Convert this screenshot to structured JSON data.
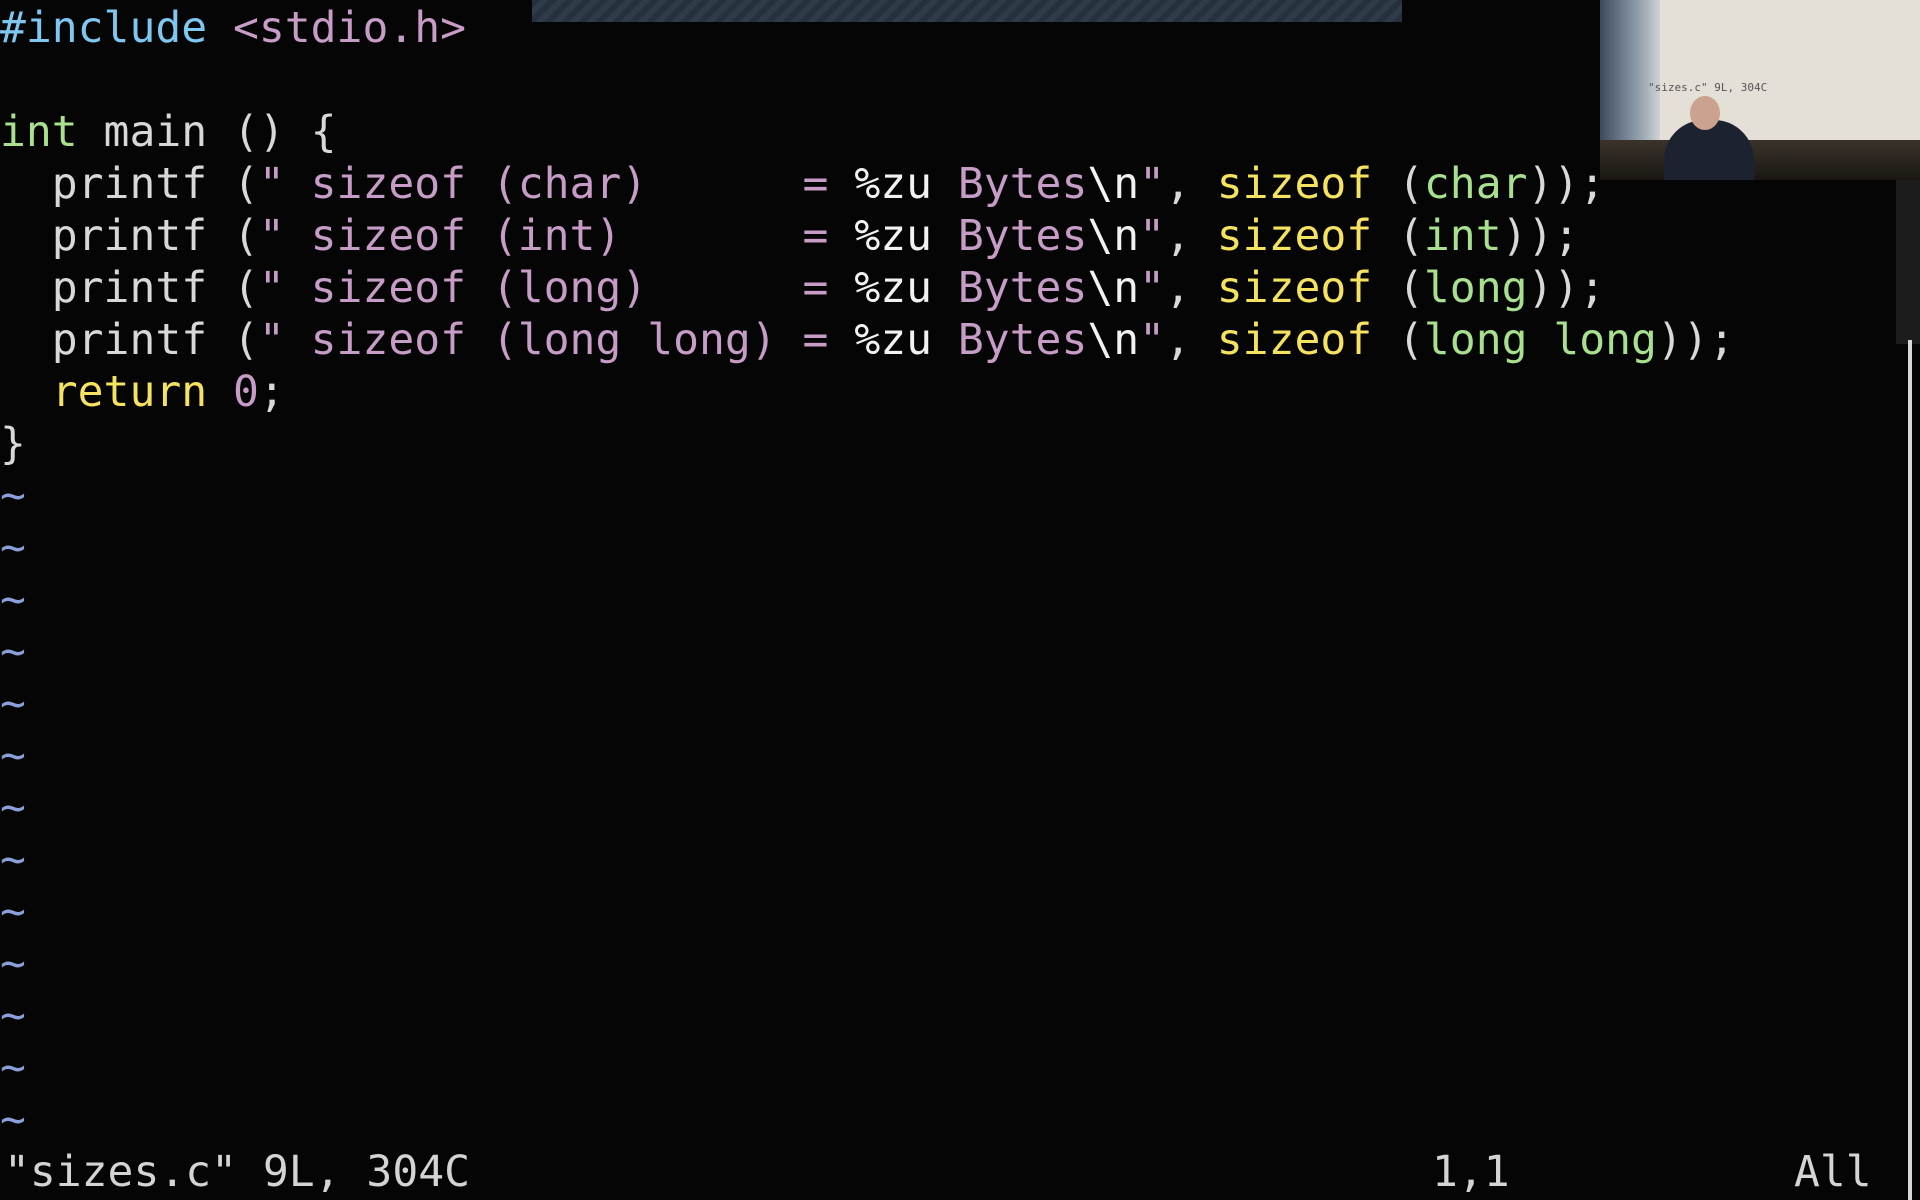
{
  "editor": {
    "lines": [
      {
        "tokens": [
          {
            "t": "#include",
            "c": "inc"
          },
          {
            "t": " ",
            "c": "plain"
          },
          {
            "t": "<stdio.h>",
            "c": "hdr"
          }
        ]
      },
      {
        "tokens": []
      },
      {
        "tokens": [
          {
            "t": "int",
            "c": "type"
          },
          {
            "t": " main () {",
            "c": "plain"
          }
        ]
      },
      {
        "tokens": [
          {
            "t": "  printf (",
            "c": "plain"
          },
          {
            "t": "\" sizeof (char)      = ",
            "c": "str"
          },
          {
            "t": "%zu",
            "c": "esc"
          },
          {
            "t": " Bytes",
            "c": "str"
          },
          {
            "t": "\\n",
            "c": "esc"
          },
          {
            "t": "\"",
            "c": "str"
          },
          {
            "t": ", ",
            "c": "plain"
          },
          {
            "t": "sizeof",
            "c": "kw"
          },
          {
            "t": " (",
            "c": "plain"
          },
          {
            "t": "char",
            "c": "type"
          },
          {
            "t": "));",
            "c": "plain"
          }
        ]
      },
      {
        "tokens": [
          {
            "t": "  printf (",
            "c": "plain"
          },
          {
            "t": "\" sizeof (int)       = ",
            "c": "str"
          },
          {
            "t": "%zu",
            "c": "esc"
          },
          {
            "t": " Bytes",
            "c": "str"
          },
          {
            "t": "\\n",
            "c": "esc"
          },
          {
            "t": "\"",
            "c": "str"
          },
          {
            "t": ", ",
            "c": "plain"
          },
          {
            "t": "sizeof",
            "c": "kw"
          },
          {
            "t": " (",
            "c": "plain"
          },
          {
            "t": "int",
            "c": "type"
          },
          {
            "t": "));",
            "c": "plain"
          }
        ]
      },
      {
        "tokens": [
          {
            "t": "  printf (",
            "c": "plain"
          },
          {
            "t": "\" sizeof (long)      = ",
            "c": "str"
          },
          {
            "t": "%zu",
            "c": "esc"
          },
          {
            "t": " Bytes",
            "c": "str"
          },
          {
            "t": "\\n",
            "c": "esc"
          },
          {
            "t": "\"",
            "c": "str"
          },
          {
            "t": ", ",
            "c": "plain"
          },
          {
            "t": "sizeof",
            "c": "kw"
          },
          {
            "t": " (",
            "c": "plain"
          },
          {
            "t": "long",
            "c": "type"
          },
          {
            "t": "));",
            "c": "plain"
          }
        ]
      },
      {
        "tokens": [
          {
            "t": "  printf (",
            "c": "plain"
          },
          {
            "t": "\" sizeof (long long) = ",
            "c": "str"
          },
          {
            "t": "%zu",
            "c": "esc"
          },
          {
            "t": " Bytes",
            "c": "str"
          },
          {
            "t": "\\n",
            "c": "esc"
          },
          {
            "t": "\"",
            "c": "str"
          },
          {
            "t": ", ",
            "c": "plain"
          },
          {
            "t": "sizeof",
            "c": "kw"
          },
          {
            "t": " (",
            "c": "plain"
          },
          {
            "t": "long long",
            "c": "type"
          },
          {
            "t": "));",
            "c": "plain"
          }
        ]
      },
      {
        "tokens": [
          {
            "t": "  ",
            "c": "plain"
          },
          {
            "t": "return",
            "c": "kw"
          },
          {
            "t": " ",
            "c": "plain"
          },
          {
            "t": "0",
            "c": "num"
          },
          {
            "t": ";",
            "c": "plain"
          }
        ]
      },
      {
        "tokens": [
          {
            "t": "}",
            "c": "plain"
          }
        ]
      }
    ],
    "empty_marker": "~",
    "empty_line_count": 13
  },
  "status_bar": {
    "message": "\"sizes.c\" 9L, 304C",
    "cursor_position": "1,1",
    "scroll_position": "All"
  },
  "webcam": {
    "screen_text": "\"sizes.c\" 9L, 304C"
  },
  "colors": {
    "background": "#050505",
    "preproc": "#7fc6f0",
    "type": "#a8e08f",
    "string": "#c79cc7",
    "keyword": "#f5e25e",
    "escape": "#f2f2f2",
    "text": "#d8d8d8",
    "tilde": "#8aa0d8"
  }
}
